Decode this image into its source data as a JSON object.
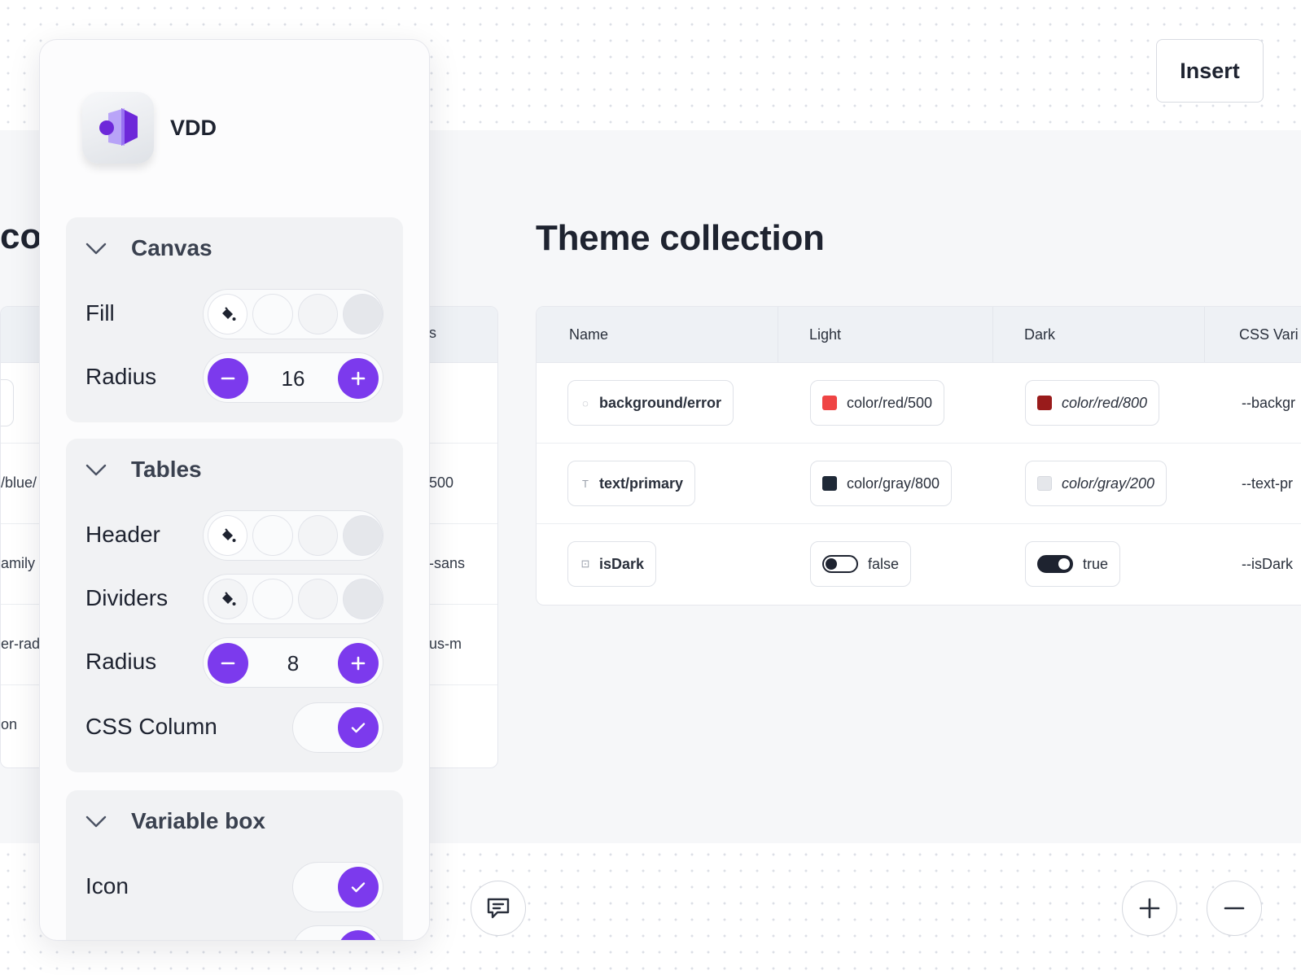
{
  "insert_button": "Insert",
  "brand": {
    "name": "VDD"
  },
  "left_fragments": {
    "title": "col",
    "header_s": "s",
    "row2_left": "/blue/",
    "row2_right": "500",
    "row3_left": "amily",
    "row3_right": "-sans",
    "row4_left": "er-rad",
    "row4_right": "us-m",
    "row5_left": "on"
  },
  "theme": {
    "title": "Theme collection",
    "columns": [
      "Name",
      "Light",
      "Dark",
      "CSS Vari"
    ],
    "rows": [
      {
        "name": "background/error",
        "light": "color/red/500",
        "light_color": "#ef4444",
        "dark": "color/red/800",
        "dark_color": "#991b1b",
        "css": "--backgr"
      },
      {
        "name": "text/primary",
        "light": "color/gray/800",
        "light_color": "#1f2937",
        "dark": "color/gray/200",
        "dark_color": "#e5e7eb",
        "css": "--text-pr"
      },
      {
        "name": "isDark",
        "light": "false",
        "dark": "true",
        "css": "--isDark"
      }
    ]
  },
  "panel": {
    "canvas": {
      "label": "Canvas",
      "fill": "Fill",
      "radius_label": "Radius",
      "radius": "16"
    },
    "tables": {
      "label": "Tables",
      "header": "Header",
      "dividers": "Dividers",
      "radius_label": "Radius",
      "radius": "8",
      "css_column": "CSS Column"
    },
    "variable_box": {
      "label": "Variable box",
      "icon": "Icon"
    }
  },
  "colors": {
    "accent": "#7c3aed",
    "swatches": [
      "#fafbfc",
      "#f3f4f6",
      "#e5e7eb"
    ]
  }
}
